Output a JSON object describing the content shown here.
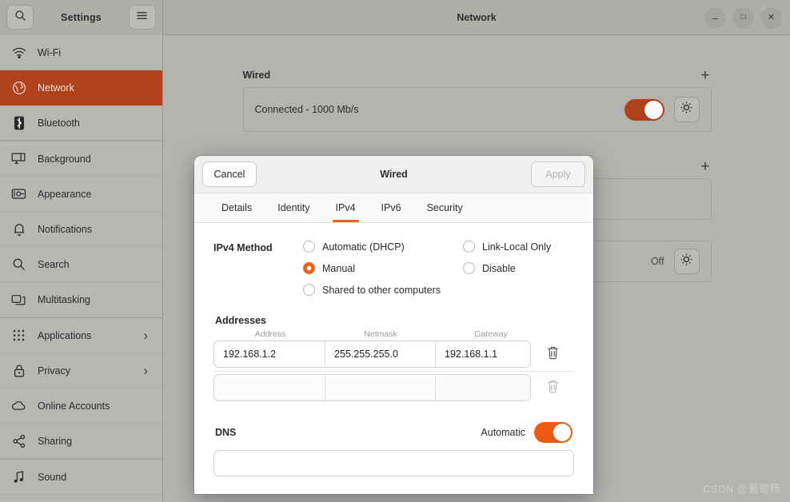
{
  "titlebar": {
    "app_title": "Settings",
    "window_title": "Network",
    "search_icon": "search-icon",
    "menu_icon": "hamburger-menu-icon",
    "minimize_label": "–",
    "maximize_label": "□",
    "close_label": "✕"
  },
  "sidebar": {
    "items": [
      {
        "label": "Wi-Fi",
        "icon": "wifi-icon",
        "active": false,
        "chevron": ""
      },
      {
        "label": "Network",
        "icon": "network-globe-icon",
        "active": true,
        "chevron": ""
      },
      {
        "label": "Bluetooth",
        "icon": "bluetooth-icon",
        "active": false,
        "chevron": ""
      },
      {
        "label": "Background",
        "icon": "background-icon",
        "active": false,
        "chevron": ""
      },
      {
        "label": "Appearance",
        "icon": "appearance-icon",
        "active": false,
        "chevron": ""
      },
      {
        "label": "Notifications",
        "icon": "bell-icon",
        "active": false,
        "chevron": ""
      },
      {
        "label": "Search",
        "icon": "search-icon",
        "active": false,
        "chevron": ""
      },
      {
        "label": "Multitasking",
        "icon": "multitasking-icon",
        "active": false,
        "chevron": ""
      },
      {
        "label": "Applications",
        "icon": "grid-apps-icon",
        "active": false,
        "chevron": "›"
      },
      {
        "label": "Privacy",
        "icon": "lock-icon",
        "active": false,
        "chevron": "›"
      },
      {
        "label": "Online Accounts",
        "icon": "cloud-icon",
        "active": false,
        "chevron": ""
      },
      {
        "label": "Sharing",
        "icon": "share-icon",
        "active": false,
        "chevron": ""
      },
      {
        "label": "Sound",
        "icon": "music-note-icon",
        "active": false,
        "chevron": ""
      }
    ]
  },
  "main": {
    "sections": [
      {
        "title": "Wired",
        "add_label": "+",
        "card_label": "Connected - 1000 Mb/s",
        "toggle_state": "on",
        "status_text": ""
      },
      {
        "title": "",
        "add_label": "+",
        "card_label": "",
        "toggle_state": "none",
        "status_text": ""
      },
      {
        "title": "",
        "add_label": "",
        "card_label": "",
        "toggle_state": "none",
        "status_text": "Off"
      }
    ]
  },
  "dialog": {
    "cancel_label": "Cancel",
    "title": "Wired",
    "apply_label": "Apply",
    "apply_enabled": false,
    "tabs": [
      {
        "label": "Details",
        "active": false
      },
      {
        "label": "Identity",
        "active": false
      },
      {
        "label": "IPv4",
        "active": true
      },
      {
        "label": "IPv6",
        "active": false
      },
      {
        "label": "Security",
        "active": false
      }
    ],
    "ipv4_method": {
      "label": "IPv4 Method",
      "selected": "Manual",
      "column_1": [
        {
          "label": "Automatic (DHCP)",
          "selected": false
        },
        {
          "label": "Manual",
          "selected": true
        },
        {
          "label": "Shared to other computers",
          "selected": false
        }
      ],
      "column_2": [
        {
          "label": "Link-Local Only",
          "selected": false
        },
        {
          "label": "Disable",
          "selected": false
        }
      ]
    },
    "addresses": {
      "title": "Addresses",
      "headers": [
        "Address",
        "Netmask",
        "Gateway"
      ],
      "rows": [
        {
          "address": "192.168.1.2",
          "netmask": "255.255.255.0",
          "gateway": "192.168.1.1",
          "delete_icon": "trash-icon"
        },
        {
          "address": "",
          "netmask": "",
          "gateway": "",
          "delete_icon": "trash-icon"
        }
      ]
    },
    "dns": {
      "title": "DNS",
      "automatic_label": "Automatic",
      "automatic_state": "on",
      "value": ""
    }
  },
  "watermark": {
    "text": "CSDN @葡萄杨"
  },
  "colors": {
    "accent_orange": "#e8641c",
    "sidebar_active": "#b0411a",
    "toggle_on": "#ec5b14",
    "window_bg": "#b5b3b0",
    "dialog_bg": "#ffffff"
  }
}
